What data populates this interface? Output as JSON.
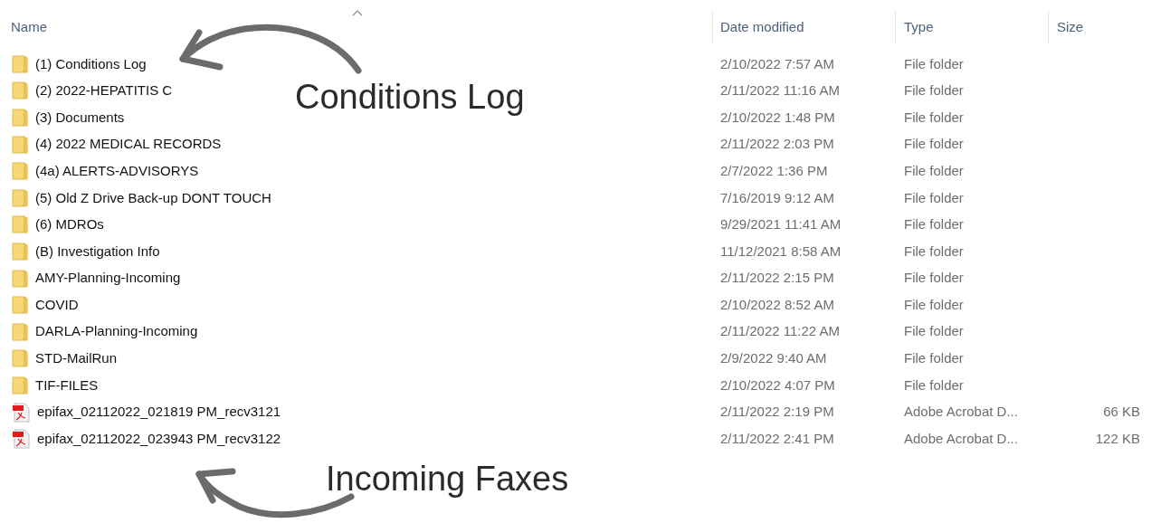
{
  "columns": [
    "Name",
    "Date modified",
    "Type",
    "Size"
  ],
  "rows": [
    {
      "kind": "folder",
      "name": "(1) Conditions Log",
      "date": "2/10/2022 7:57 AM",
      "type": "File folder"
    },
    {
      "kind": "folder",
      "name": "(2) 2022-HEPATITIS C",
      "date": "2/11/2022 11:16 AM",
      "type": "File folder"
    },
    {
      "kind": "folder",
      "name": "(3) Documents",
      "date": "2/10/2022 1:48 PM",
      "type": "File folder"
    },
    {
      "kind": "folder",
      "name": "(4) 2022 MEDICAL RECORDS",
      "date": "2/11/2022 2:03 PM",
      "type": "File folder"
    },
    {
      "kind": "folder",
      "name": "(4a) ALERTS-ADVISORYS",
      "date": "2/7/2022 1:36 PM",
      "type": "File folder"
    },
    {
      "kind": "folder",
      "name": "(5) Old Z Drive Back-up DONT TOUCH",
      "date": "7/16/2019 9:12 AM",
      "type": "File folder"
    },
    {
      "kind": "folder",
      "name": "(6) MDROs",
      "date": "9/29/2021 11:41 AM",
      "type": "File folder"
    },
    {
      "kind": "folder",
      "name": "(B) Investigation Info",
      "date": "11/12/2021 8:58 AM",
      "type": "File folder"
    },
    {
      "kind": "folder",
      "name": "AMY-Planning-Incoming",
      "date": "2/11/2022 2:15 PM",
      "type": "File folder"
    },
    {
      "kind": "folder",
      "name": "COVID",
      "date": "2/10/2022 8:52 AM",
      "type": "File folder"
    },
    {
      "kind": "folder",
      "name": "DARLA-Planning-Incoming",
      "date": "2/11/2022 11:22 AM",
      "type": "File folder"
    },
    {
      "kind": "folder",
      "name": "STD-MailRun",
      "date": "2/9/2022 9:40 AM",
      "type": "File folder"
    },
    {
      "kind": "folder",
      "name": "TIF-FILES",
      "date": "2/10/2022 4:07 PM",
      "type": "File folder"
    },
    {
      "kind": "pdf",
      "name": "epifax_02112022_021819 PM_recv3121",
      "date": "2/11/2022 2:19 PM",
      "type": "Adobe Acrobat D...",
      "size": "66 KB"
    },
    {
      "kind": "pdf",
      "name": "epifax_02112022_023943 PM_recv3122",
      "date": "2/11/2022 2:41 PM",
      "type": "Adobe Acrobat D...",
      "size": "122 KB"
    }
  ],
  "annotations": [
    "Conditions Log",
    "Incoming Faxes"
  ]
}
